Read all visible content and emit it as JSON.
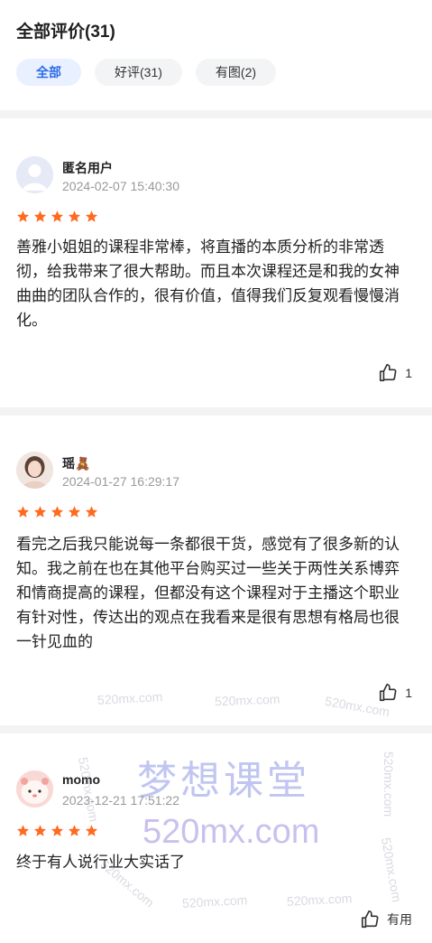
{
  "header": {
    "title": "全部评价(31)",
    "tabs": [
      {
        "label": "全部",
        "active": true
      },
      {
        "label": "好评(31)",
        "active": false
      },
      {
        "label": "有图(2)",
        "active": false
      }
    ]
  },
  "reviews": [
    {
      "user": "匿名用户",
      "time": "2024-02-07 15:40:30",
      "rating": 5,
      "content": "善雅小姐姐的课程非常棒，将直播的本质分析的非常透彻，给我带来了很大帮助。而且本次课程还是和我的女神曲曲的团队合作的，很有价值，值得我们反复观看慢慢消化。",
      "likes": "1"
    },
    {
      "user": "瑶🧸",
      "time": "2024-01-27 16:29:17",
      "rating": 5,
      "content": "看完之后我只能说每一条都很干货，感觉有了很多新的认知。我之前在也在其他平台购买过一些关于两性关系博弈和情商提高的课程，但都没有这个课程对于主播这个职业有针对性，传达出的观点在我看来是很有思想有格局也很一针见血的",
      "likes": "1"
    },
    {
      "user": "momo",
      "time": "2023-12-21 17:51:22",
      "rating": 5,
      "content": "终于有人说行业大实话了",
      "likes": "有用"
    }
  ],
  "watermark": {
    "text": "520mx.com",
    "brand": "梦想课堂",
    "url": "520mx.com"
  },
  "colors": {
    "star": "#ff6a1f",
    "tab_active_bg": "#e9f0ff",
    "tab_active_text": "#2b6de8"
  }
}
